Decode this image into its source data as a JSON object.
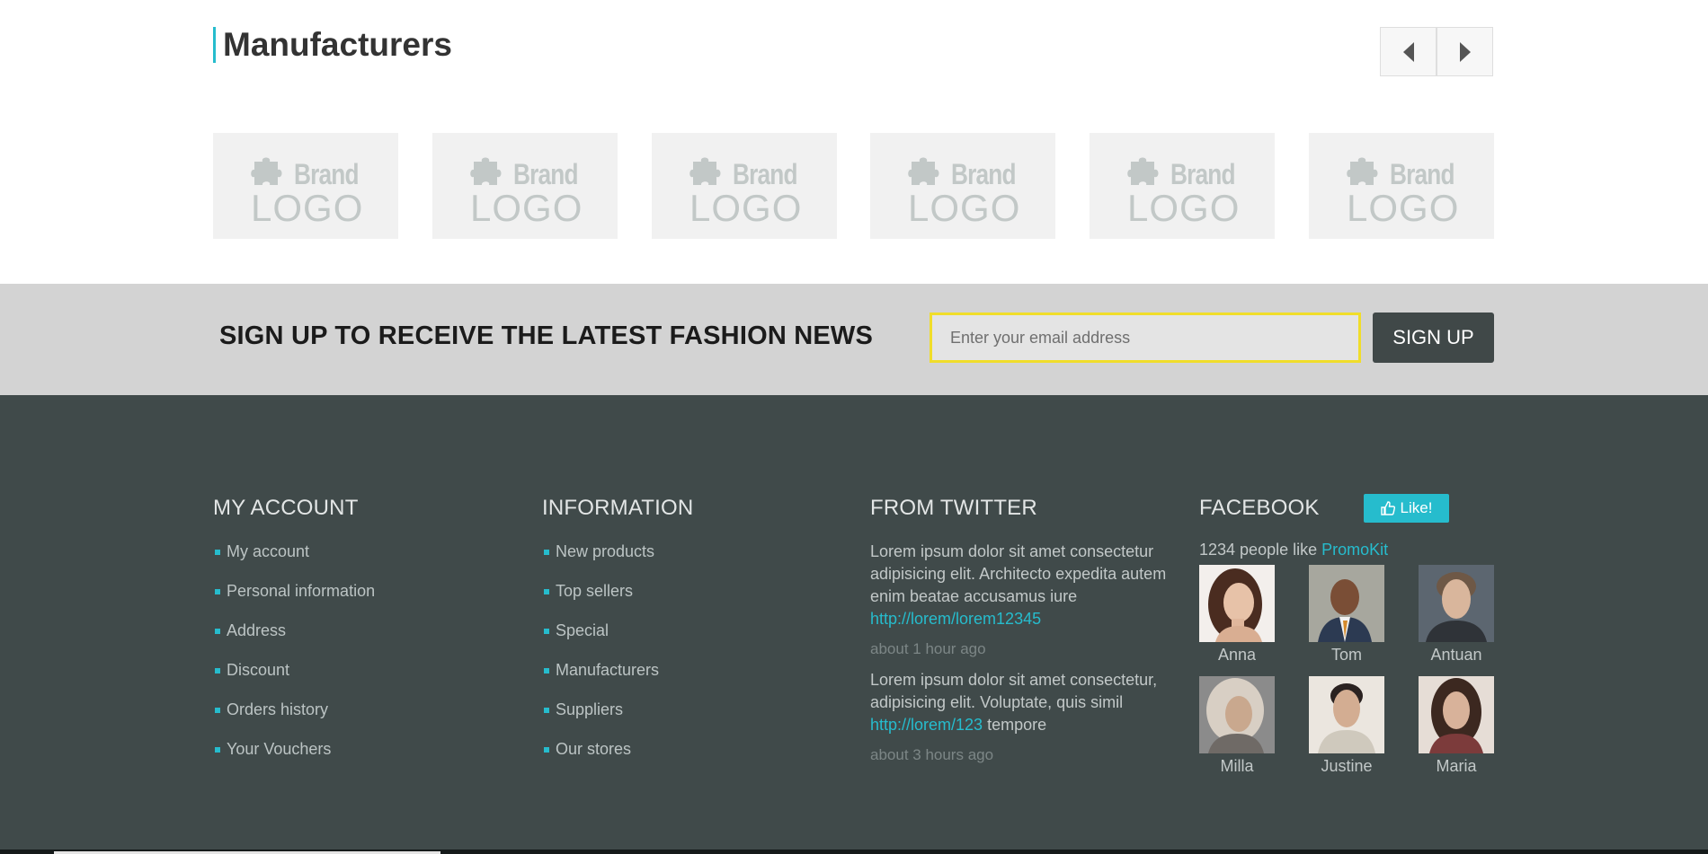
{
  "manufacturers": {
    "title": "Manufacturers",
    "logos": [
      {
        "brand": "Brand",
        "logo": "LOGO"
      },
      {
        "brand": "Brand",
        "logo": "LOGO"
      },
      {
        "brand": "Brand",
        "logo": "LOGO"
      },
      {
        "brand": "Brand",
        "logo": "LOGO"
      },
      {
        "brand": "Brand",
        "logo": "LOGO"
      },
      {
        "brand": "Brand",
        "logo": "LOGO"
      }
    ],
    "prev_icon": "triangle-left-icon",
    "next_icon": "triangle-right-icon"
  },
  "newsletter": {
    "heading": "SIGN UP TO RECEIVE THE LATEST FASHION NEWS",
    "placeholder": "Enter your email address",
    "button": "SIGN UP"
  },
  "footer": {
    "account": {
      "title": "MY ACCOUNT",
      "links": [
        "My account",
        "Personal information",
        "Address",
        "Discount",
        "Orders history",
        "Your Vouchers"
      ]
    },
    "information": {
      "title": "INFORMATION",
      "links": [
        "New products",
        "Top sellers",
        "Special",
        "Manufacturers",
        "Suppliers",
        "Our stores"
      ]
    },
    "twitter": {
      "title": "FROM TWITTER",
      "tweets": [
        {
          "text": "Lorem ipsum dolor sit amet consectetur adipisicing elit. Architecto expedita autem enim beatae accusamus iure",
          "link": "http://lorem/lorem12345",
          "after": "",
          "time": "about 1 hour ago"
        },
        {
          "text": "Lorem ipsum dolor sit amet consectetur, adipisicing elit. Voluptate, quis simil",
          "link": "http://lorem/123",
          "after": " tempore",
          "time": "about 3 hours ago"
        }
      ]
    },
    "facebook": {
      "title": "FACEBOOK",
      "like_button": "Like!",
      "like_icon": "thumbs-up-icon",
      "count_text": "1234 people like ",
      "page_link": "PromoKit",
      "people": [
        "Anna",
        "Tom",
        "Antuan",
        "Milla",
        "Justine",
        "Maria"
      ]
    }
  },
  "colors": {
    "accent": "#26bccd",
    "footer_bg": "#404a4a",
    "newsletter_bg": "#d3d3d3",
    "input_border": "#f0dd2a",
    "signup_button_bg": "#404848"
  }
}
